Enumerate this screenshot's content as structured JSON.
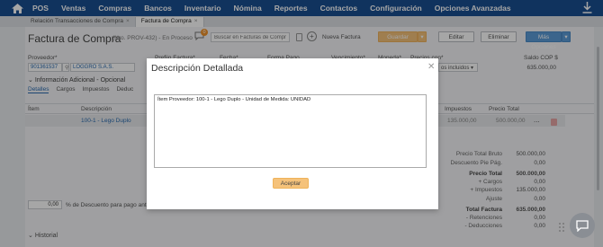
{
  "nav": {
    "items": [
      "POS",
      "Ventas",
      "Compras",
      "Bancos",
      "Inventario",
      "Nómina",
      "Reportes",
      "Contactos",
      "Configuración",
      "Opciones Avanzadas"
    ],
    "color": "#1a4f91"
  },
  "tabs": [
    {
      "label": "Relación Transacciones de Compra",
      "active": false
    },
    {
      "label": "Factura de Compra",
      "active": true
    }
  ],
  "header": {
    "title": "Factura de Compra",
    "subtitle": "(Nro. PROV-432) - En Proceso",
    "notif_count": "0",
    "search_placeholder": "Buscar en Facturas de Compra",
    "nueva": "Nueva Factura",
    "guardar": "Guardar",
    "editar": "Editar",
    "eliminar": "Eliminar",
    "mas_opciones": "Más Opciones"
  },
  "form": {
    "proveedor_label": "Proveedor*",
    "proveedor_id": "901361537",
    "proveedor_name": "LOGGRO S.A.S.",
    "prefijo_label": "Prefijo Factura*",
    "fecha_label": "Fecha*",
    "forma_pago_label": "Forma Pago",
    "vencimiento_label": "Vencimiento*",
    "moneda_label": "Moneda*",
    "precios_label": "Precios con*",
    "precios_value": "os incluidos",
    "saldo_label": "Saldo COP $",
    "saldo_value": "635.000,00",
    "info_label": "Información Adicional - Opcional"
  },
  "subtabs": [
    "Detalles",
    "Cargos",
    "Impuestos",
    "Deduc"
  ],
  "table": {
    "headers": {
      "item": "Ítem",
      "descripcion": "Descripción",
      "impuestos": "Impuestos",
      "precio_total": "Precio Total"
    },
    "row": {
      "descripcion": "100-1 - Lego Duplo",
      "impuestos": "135.000,00",
      "precio_total": "500.000,00",
      "more": "..."
    }
  },
  "totals": [
    {
      "label": "Precio Total Bruto",
      "value": "500.000,00",
      "bold": false
    },
    {
      "label": "Descuento Pie Pág.",
      "value": "0,00",
      "bold": false
    },
    {
      "label": "Precio Total",
      "value": "500.000,00",
      "bold": true
    },
    {
      "label": "+ Cargos",
      "value": "0,00",
      "bold": false
    },
    {
      "label": "+ Impuestos",
      "value": "135.000,00",
      "bold": false
    },
    {
      "label": "Ajuste",
      "value": "0,00",
      "bold": false
    },
    {
      "label": "Total Factura",
      "value": "635.000,00",
      "bold": true
    },
    {
      "label": "- Retenciones",
      "value": "0,00",
      "bold": false
    },
    {
      "label": "- Deducciones",
      "value": "0,00",
      "bold": false
    }
  ],
  "discount": {
    "value": "0,00",
    "label": "% de Descuento para pago antes"
  },
  "historial": "Historial",
  "modal": {
    "title": "Descripción Detallada",
    "text": "Ítem Proveedor: 100-1 - Lego Duplo - Unidad de Medida: UNIDAD",
    "button": "Aceptar"
  }
}
